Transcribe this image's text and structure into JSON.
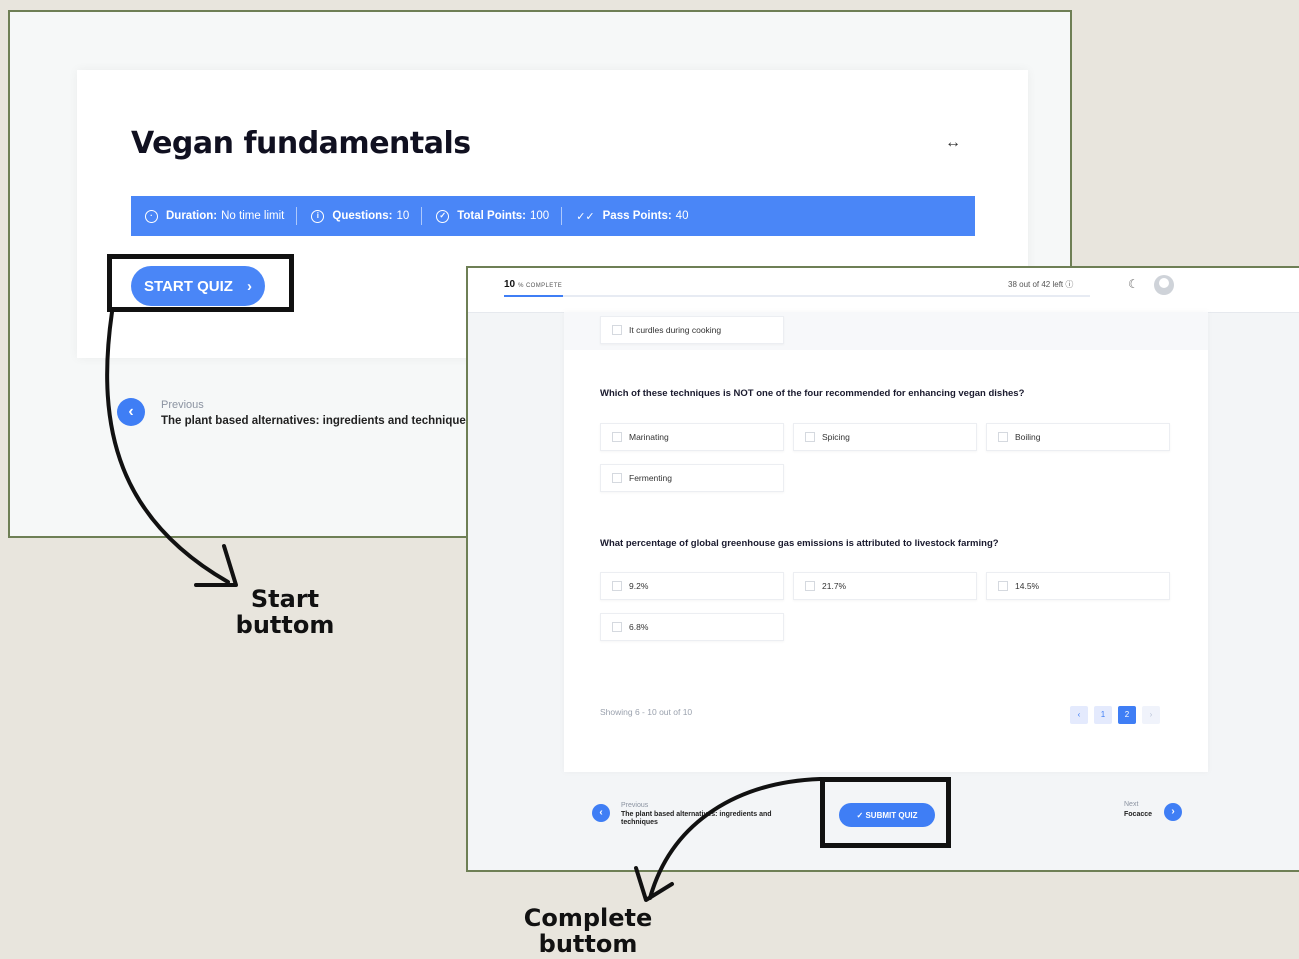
{
  "quiz_intro": {
    "title": "Vegan fundamentals",
    "expand_icon": "expand-horizontal-icon",
    "info": {
      "duration_label": "Duration:",
      "duration_value": "No time limit",
      "questions_label": "Questions:",
      "questions_value": "10",
      "total_points_label": "Total Points:",
      "total_points_value": "100",
      "pass_points_label": "Pass Points:",
      "pass_points_value": "40"
    },
    "start_button_label": "START QUIZ",
    "previous": {
      "label": "Previous",
      "title": "The plant based alternatives: ingredients and techniques"
    }
  },
  "quiz_page": {
    "progress": {
      "percent_number": "10",
      "percent_sign": "%",
      "complete_label": "COMPLETE",
      "fraction": 0.1
    },
    "time_left": "38 out of 42 left ⓘ",
    "partial_option": "It curdles during cooking",
    "questions": [
      {
        "text": "Which of these techniques is NOT one of the four recommended for enhancing vegan dishes?",
        "options": [
          "Marinating",
          "Spicing",
          "Boiling",
          "Fermenting"
        ]
      },
      {
        "text": "What percentage of global greenhouse gas emissions is attributed to livestock farming?",
        "options": [
          "9.2%",
          "21.7%",
          "14.5%",
          "6.8%"
        ]
      }
    ],
    "showing": "Showing 6 - 10 out of 10",
    "pagination": {
      "prev": "‹",
      "pages": [
        "1",
        "2"
      ],
      "active_page": "2",
      "next": "›"
    },
    "submit_button_label": "✓  SUBMIT QUIZ",
    "previous": {
      "label": "Previous",
      "title": "The plant based alternatives: ingredients and techniques"
    },
    "next": {
      "label": "Next",
      "title": "Focacce"
    }
  },
  "annotations": {
    "start_line1": "Start",
    "start_line2": "buttom",
    "complete_line1": "Complete",
    "complete_line2": "buttom"
  },
  "colors": {
    "background": "#e8e5dd",
    "frame_border": "#6e7f55",
    "primary_blue": "#4a86f7"
  }
}
